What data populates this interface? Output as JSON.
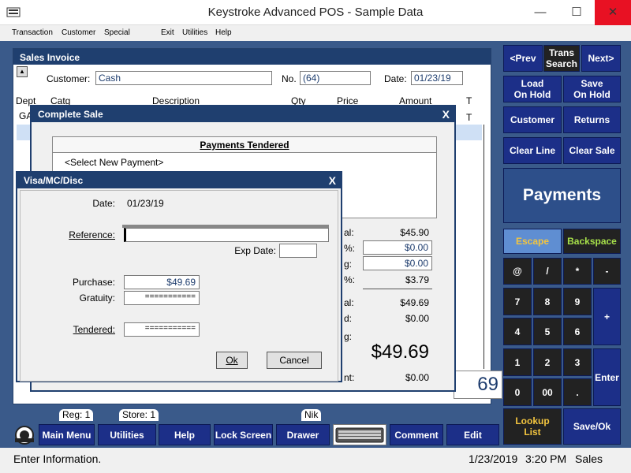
{
  "window": {
    "title": "Keystroke Advanced POS - Sample Data",
    "min": "—",
    "max": "☐",
    "close": "✕"
  },
  "menu": [
    "Transaction",
    "Customer",
    "Special",
    "Exit",
    "Utilities",
    "Help"
  ],
  "invoice": {
    "title": "Sales Invoice",
    "sort_glyph": "▲",
    "customer_label": "Customer:",
    "customer_value": "Cash",
    "no_label": "No.",
    "no_value": "(64)",
    "date_label": "Date:",
    "date_value": "01/23/19",
    "columns": [
      "Dept",
      "Catg",
      "Description",
      "Qty",
      "Price",
      "Amount",
      "T"
    ],
    "row1": {
      "dept": "GA",
      "t": "T"
    },
    "total_partial": "69"
  },
  "keypad": {
    "prev": "<Prev",
    "trans_search": "Trans\nSearch",
    "next": "Next>",
    "load_hold": "Load\nOn Hold",
    "save_hold": "Save\nOn Hold",
    "customer": "Customer",
    "returns": "Returns",
    "clear_line": "Clear Line",
    "clear_sale": "Clear Sale",
    "payments": "Payments",
    "escape": "Escape",
    "backspace": "Backspace",
    "at": "@",
    "slash": "/",
    "star": "*",
    "minus": "-",
    "k7": "7",
    "k8": "8",
    "k9": "9",
    "plus": "+",
    "k4": "4",
    "k5": "5",
    "k6": "6",
    "k1": "1",
    "k2": "2",
    "k3": "3",
    "enter": "Enter",
    "k0": "0",
    "k00": "00",
    "dot": ".",
    "lookup": "Lookup\nList",
    "save_ok": "Save/Ok"
  },
  "tabs": {
    "reg": "Reg: 1",
    "store": "Store: 1",
    "user": "Nik"
  },
  "toolbar": {
    "main_menu": "Main Menu",
    "utilities": "Utilities",
    "help": "Help",
    "lock_screen": "Lock Screen",
    "drawer": "Drawer",
    "comment": "Comment",
    "edit": "Edit"
  },
  "status": {
    "message": "Enter Information.",
    "date": "1/23/2019",
    "time": "3:20 PM",
    "mode": "Sales"
  },
  "complete_sale": {
    "title": "Complete Sale",
    "close": "X",
    "payments_header": "Payments Tendered",
    "select_new": "<Select New Payment>",
    "lbl1": "al:",
    "val1": "$45.90",
    "lbl2": "%:",
    "val2": "$0.00",
    "lbl3": "g:",
    "val3": "$0.00",
    "lbl4": "%:",
    "val4": "$3.79",
    "lbl5": "al:",
    "val5": "$49.69",
    "lbl6": "d:",
    "val6": "$0.00",
    "lbl7": "g:",
    "val7": "$49.69",
    "lbl8": "nt:",
    "val8": "$0.00"
  },
  "visa": {
    "title": "Visa/MC/Disc",
    "close": "X",
    "date_label": "Date:",
    "date_value": "01/23/19",
    "reference_label": "Reference:",
    "reference_value": "",
    "exp_label": "Exp Date:",
    "exp_value": "",
    "purchase_label": "Purchase:",
    "purchase_value": "$49.69",
    "gratuity_label": "Gratuity:",
    "gratuity_value": "===========",
    "tendered_label": "Tendered:",
    "tendered_value": "===========",
    "ok": "Ok",
    "cancel": "Cancel"
  }
}
